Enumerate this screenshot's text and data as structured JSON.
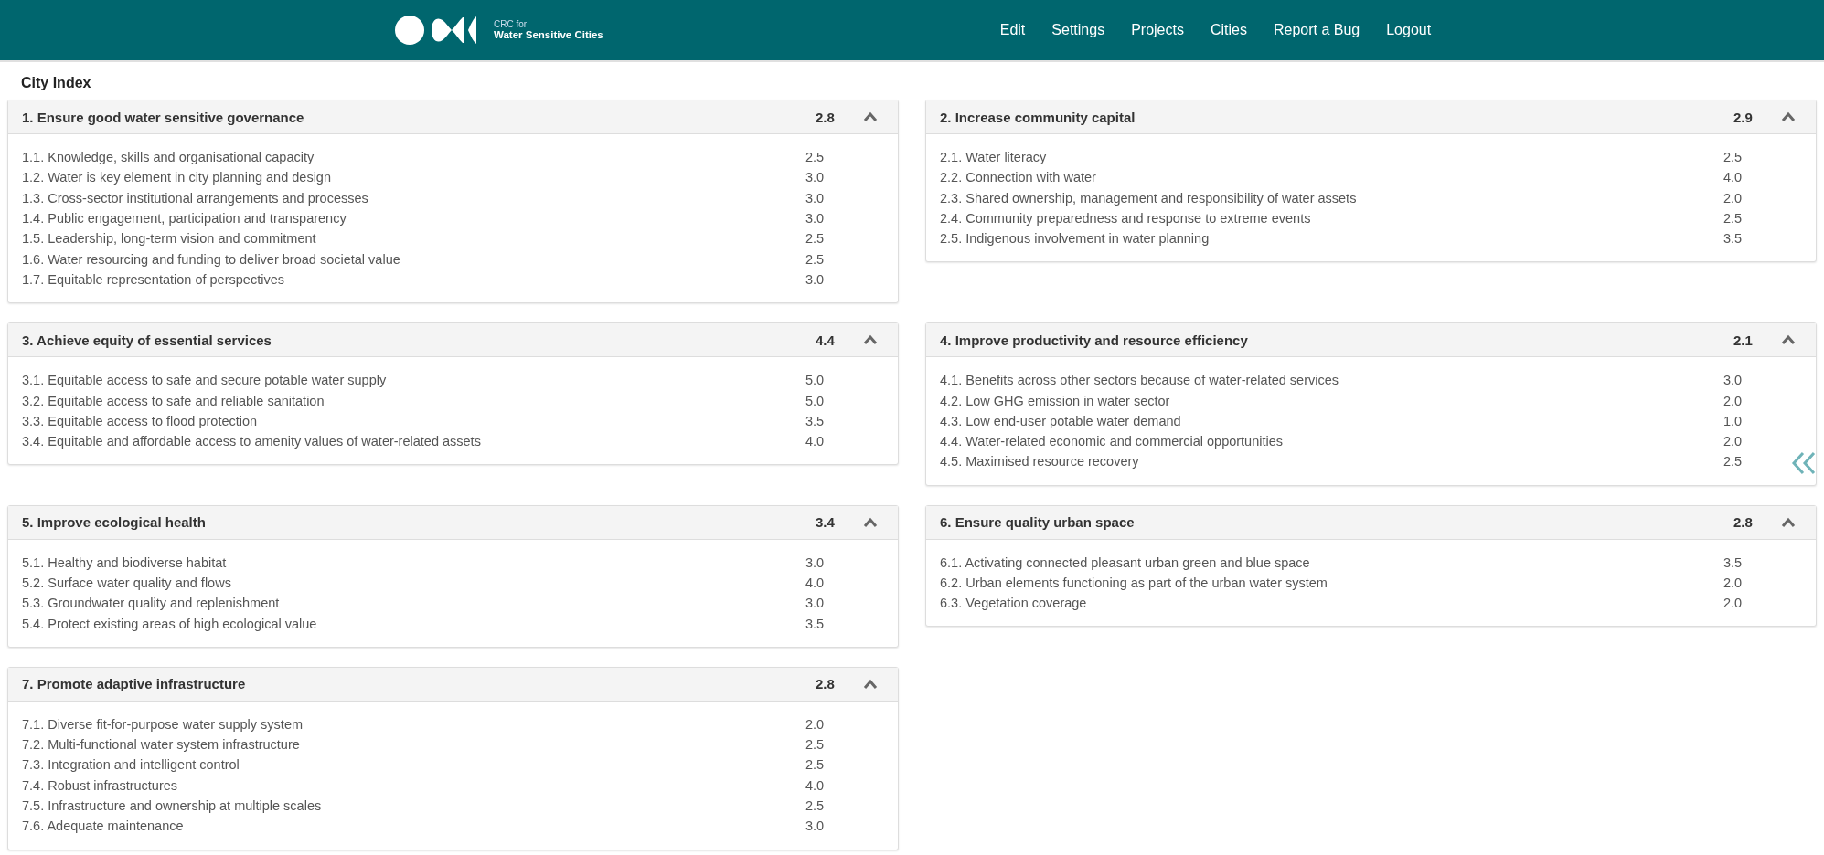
{
  "header": {
    "logo_small": "CRC for",
    "logo_name": "Water Sensitive Cities",
    "nav": [
      "Edit",
      "Settings",
      "Projects",
      "Cities",
      "Report a Bug",
      "Logout"
    ]
  },
  "page_title": "City Index",
  "panels": [
    {
      "title": "1. Ensure good water sensitive governance",
      "score": "2.8",
      "expanded": true,
      "items": [
        {
          "label": "1.1. Knowledge, skills and organisational capacity",
          "score": "2.5"
        },
        {
          "label": "1.2. Water is key element in city planning and design",
          "score": "3.0"
        },
        {
          "label": "1.3. Cross-sector institutional arrangements and processes",
          "score": "3.0"
        },
        {
          "label": "1.4. Public engagement, participation and transparency",
          "score": "3.0"
        },
        {
          "label": "1.5. Leadership, long-term vision and commitment",
          "score": "2.5"
        },
        {
          "label": "1.6. Water resourcing and funding to deliver broad societal value",
          "score": "2.5"
        },
        {
          "label": "1.7. Equitable representation of perspectives",
          "score": "3.0"
        }
      ]
    },
    {
      "title": "2. Increase community capital",
      "score": "2.9",
      "expanded": true,
      "items": [
        {
          "label": "2.1. Water literacy",
          "score": "2.5"
        },
        {
          "label": "2.2. Connection with water",
          "score": "4.0"
        },
        {
          "label": "2.3. Shared ownership, management and responsibility of water assets",
          "score": "2.0"
        },
        {
          "label": "2.4. Community preparedness and response to extreme events",
          "score": "2.5"
        },
        {
          "label": "2.5. Indigenous involvement in water planning",
          "score": "3.5"
        }
      ]
    },
    {
      "title": "3. Achieve equity of essential services",
      "score": "4.4",
      "expanded": true,
      "items": [
        {
          "label": "3.1. Equitable access to safe and secure potable water supply",
          "score": "5.0"
        },
        {
          "label": "3.2. Equitable access to safe and reliable sanitation",
          "score": "5.0"
        },
        {
          "label": "3.3. Equitable access to flood protection",
          "score": "3.5"
        },
        {
          "label": "3.4. Equitable and affordable access to amenity values of water-related assets",
          "score": "4.0"
        }
      ]
    },
    {
      "title": "4. Improve productivity and resource efficiency",
      "score": "2.1",
      "expanded": true,
      "items": [
        {
          "label": "4.1. Benefits across other sectors because of water-related services",
          "score": "3.0"
        },
        {
          "label": "4.2. Low GHG emission in water sector",
          "score": "2.0"
        },
        {
          "label": "4.3. Low end-user potable water demand",
          "score": "1.0"
        },
        {
          "label": "4.4. Water-related economic and commercial opportunities",
          "score": "2.0"
        },
        {
          "label": "4.5. Maximised resource recovery",
          "score": "2.5"
        }
      ]
    },
    {
      "title": "5. Improve ecological health",
      "score": "3.4",
      "expanded": true,
      "items": [
        {
          "label": "5.1. Healthy and biodiverse habitat",
          "score": "3.0"
        },
        {
          "label": "5.2. Surface water quality and flows",
          "score": "4.0"
        },
        {
          "label": "5.3. Groundwater quality and replenishment",
          "score": "3.0"
        },
        {
          "label": "5.4. Protect existing areas of high ecological value",
          "score": "3.5"
        }
      ]
    },
    {
      "title": "6. Ensure quality urban space",
      "score": "2.8",
      "expanded": true,
      "items": [
        {
          "label": "6.1. Activating connected pleasant urban green and blue space",
          "score": "3.5"
        },
        {
          "label": "6.2. Urban elements functioning as part of the urban water system",
          "score": "2.0"
        },
        {
          "label": "6.3. Vegetation coverage",
          "score": "2.0"
        }
      ]
    },
    {
      "title": "7. Promote adaptive infrastructure",
      "score": "2.8",
      "expanded": true,
      "items": [
        {
          "label": "7.1. Diverse fit-for-purpose water supply system",
          "score": "2.0"
        },
        {
          "label": "7.2. Multi-functional water system infrastructure",
          "score": "2.5"
        },
        {
          "label": "7.3. Integration and intelligent control",
          "score": "2.5"
        },
        {
          "label": "7.4. Robust infrastructures",
          "score": "4.0"
        },
        {
          "label": "7.5. Infrastructure and ownership at multiple scales",
          "score": "2.5"
        },
        {
          "label": "7.6. Adequate maintenance",
          "score": "3.0"
        }
      ]
    }
  ]
}
